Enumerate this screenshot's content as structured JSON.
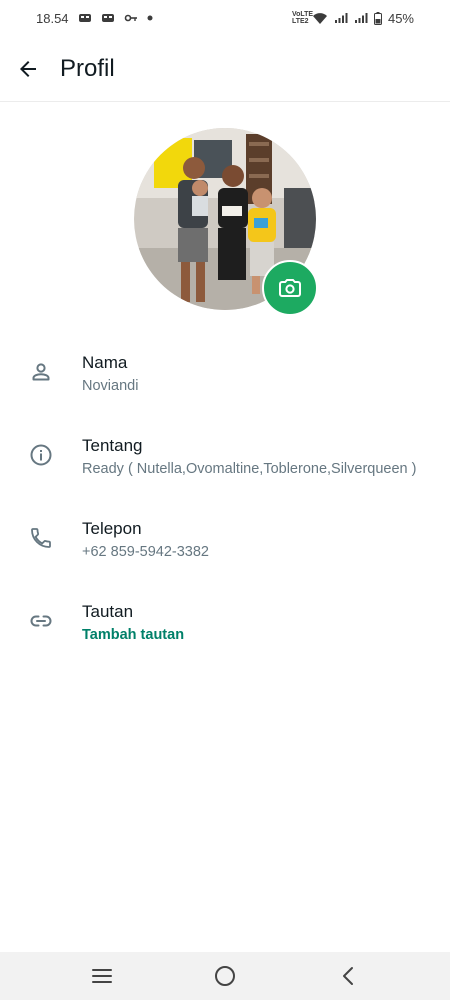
{
  "status_bar": {
    "time": "18.54",
    "battery": "45%",
    "volte_line1": "VoLTE",
    "volte_line2": "LTE2"
  },
  "app_bar": {
    "title": "Profil"
  },
  "profile": {
    "rows": [
      {
        "label": "Nama",
        "value": "Noviandi",
        "icon": "person-icon"
      },
      {
        "label": "Tentang",
        "value": "Ready ( Nutella,Ovomaltine,Toblerone,Silverqueen )",
        "icon": "info-icon"
      },
      {
        "label": "Telepon",
        "value": "+62 859-5942-3382",
        "icon": "phone-icon"
      },
      {
        "label": "Tautan",
        "value": "Tambah tautan",
        "icon": "link-icon"
      }
    ]
  },
  "nav_bar": {
    "icons": [
      "menu-icon",
      "home-circle-icon",
      "back-chevron-icon"
    ]
  },
  "colors": {
    "accent": "#1daa61",
    "link": "#008069",
    "secondary_text": "#667781"
  }
}
